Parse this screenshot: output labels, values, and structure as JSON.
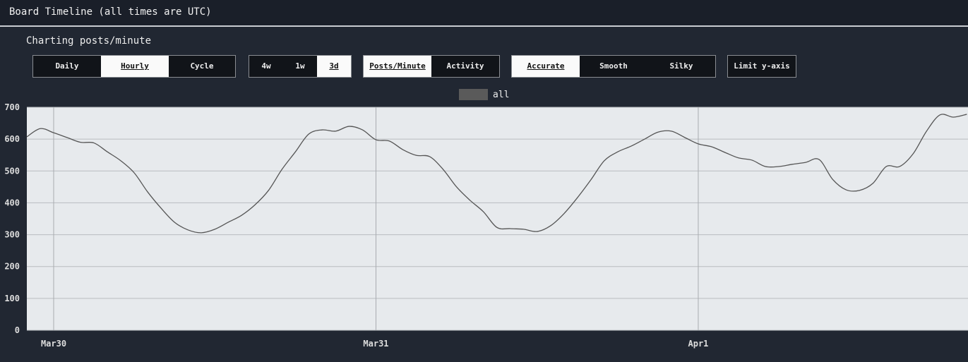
{
  "header": {
    "title": "Board Timeline (all times are UTC)"
  },
  "subtitle": "Charting posts/minute",
  "controls": {
    "interval": [
      {
        "label": "Daily",
        "active": false
      },
      {
        "label": "Hourly",
        "active": true
      },
      {
        "label": "Cycle",
        "active": false
      }
    ],
    "range": [
      {
        "label": "4w",
        "active": false
      },
      {
        "label": "1w",
        "active": false
      },
      {
        "label": "3d",
        "active": true
      }
    ],
    "metric": [
      {
        "label": "Posts/Minute",
        "active": true
      },
      {
        "label": "Activity",
        "active": false
      }
    ],
    "smoothing": [
      {
        "label": "Accurate",
        "active": true
      },
      {
        "label": "Smooth",
        "active": false
      },
      {
        "label": "Silky",
        "active": false
      }
    ],
    "limit_y": "Limit y-axis"
  },
  "chart_data": {
    "type": "line",
    "title": "",
    "xlabel": "",
    "ylabel": "posts/minute",
    "ylim": [
      0,
      700
    ],
    "yticks": [
      0,
      100,
      200,
      300,
      400,
      500,
      600,
      700
    ],
    "xticks": [
      {
        "label": "Mar30",
        "hour": 0
      },
      {
        "label": "Mar31",
        "hour": 24
      },
      {
        "label": "Apr1",
        "hour": 48
      }
    ],
    "x_unit": "hours since Mar30 00:00 UTC",
    "xlim": [
      -2,
      68.2
    ],
    "grid": true,
    "legend": "top-center",
    "series": [
      {
        "name": "all",
        "color": "#555555",
        "x_start": -2,
        "x_step": 1,
        "values": [
          607,
          633,
          620,
          605,
          590,
          588,
          560,
          532,
          494,
          434,
          383,
          339,
          315,
          306,
          317,
          339,
          361,
          394,
          439,
          505,
          560,
          616,
          629,
          625,
          640,
          629,
          598,
          594,
          567,
          549,
          545,
          505,
          450,
          408,
          372,
          323,
          319,
          317,
          310,
          328,
          366,
          416,
          472,
          532,
          560,
          578,
          600,
          622,
          625,
          605,
          585,
          576,
          558,
          541,
          534,
          514,
          514,
          521,
          527,
          536,
          474,
          441,
          439,
          461,
          514,
          514,
          554,
          625,
          676,
          669,
          678
        ]
      }
    ]
  }
}
